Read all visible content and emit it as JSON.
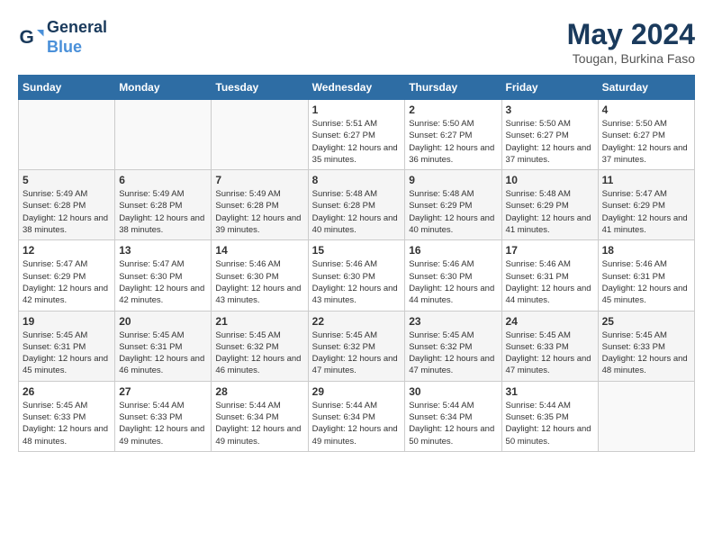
{
  "logo": {
    "line1": "General",
    "line2": "Blue"
  },
  "title": "May 2024",
  "location": "Tougan, Burkina Faso",
  "days_of_week": [
    "Sunday",
    "Monday",
    "Tuesday",
    "Wednesday",
    "Thursday",
    "Friday",
    "Saturday"
  ],
  "weeks": [
    [
      {
        "day": "",
        "sunrise": "",
        "sunset": "",
        "daylight": ""
      },
      {
        "day": "",
        "sunrise": "",
        "sunset": "",
        "daylight": ""
      },
      {
        "day": "",
        "sunrise": "",
        "sunset": "",
        "daylight": ""
      },
      {
        "day": "1",
        "sunrise": "Sunrise: 5:51 AM",
        "sunset": "Sunset: 6:27 PM",
        "daylight": "Daylight: 12 hours and 35 minutes."
      },
      {
        "day": "2",
        "sunrise": "Sunrise: 5:50 AM",
        "sunset": "Sunset: 6:27 PM",
        "daylight": "Daylight: 12 hours and 36 minutes."
      },
      {
        "day": "3",
        "sunrise": "Sunrise: 5:50 AM",
        "sunset": "Sunset: 6:27 PM",
        "daylight": "Daylight: 12 hours and 37 minutes."
      },
      {
        "day": "4",
        "sunrise": "Sunrise: 5:50 AM",
        "sunset": "Sunset: 6:27 PM",
        "daylight": "Daylight: 12 hours and 37 minutes."
      }
    ],
    [
      {
        "day": "5",
        "sunrise": "Sunrise: 5:49 AM",
        "sunset": "Sunset: 6:28 PM",
        "daylight": "Daylight: 12 hours and 38 minutes."
      },
      {
        "day": "6",
        "sunrise": "Sunrise: 5:49 AM",
        "sunset": "Sunset: 6:28 PM",
        "daylight": "Daylight: 12 hours and 38 minutes."
      },
      {
        "day": "7",
        "sunrise": "Sunrise: 5:49 AM",
        "sunset": "Sunset: 6:28 PM",
        "daylight": "Daylight: 12 hours and 39 minutes."
      },
      {
        "day": "8",
        "sunrise": "Sunrise: 5:48 AM",
        "sunset": "Sunset: 6:28 PM",
        "daylight": "Daylight: 12 hours and 40 minutes."
      },
      {
        "day": "9",
        "sunrise": "Sunrise: 5:48 AM",
        "sunset": "Sunset: 6:29 PM",
        "daylight": "Daylight: 12 hours and 40 minutes."
      },
      {
        "day": "10",
        "sunrise": "Sunrise: 5:48 AM",
        "sunset": "Sunset: 6:29 PM",
        "daylight": "Daylight: 12 hours and 41 minutes."
      },
      {
        "day": "11",
        "sunrise": "Sunrise: 5:47 AM",
        "sunset": "Sunset: 6:29 PM",
        "daylight": "Daylight: 12 hours and 41 minutes."
      }
    ],
    [
      {
        "day": "12",
        "sunrise": "Sunrise: 5:47 AM",
        "sunset": "Sunset: 6:29 PM",
        "daylight": "Daylight: 12 hours and 42 minutes."
      },
      {
        "day": "13",
        "sunrise": "Sunrise: 5:47 AM",
        "sunset": "Sunset: 6:30 PM",
        "daylight": "Daylight: 12 hours and 42 minutes."
      },
      {
        "day": "14",
        "sunrise": "Sunrise: 5:46 AM",
        "sunset": "Sunset: 6:30 PM",
        "daylight": "Daylight: 12 hours and 43 minutes."
      },
      {
        "day": "15",
        "sunrise": "Sunrise: 5:46 AM",
        "sunset": "Sunset: 6:30 PM",
        "daylight": "Daylight: 12 hours and 43 minutes."
      },
      {
        "day": "16",
        "sunrise": "Sunrise: 5:46 AM",
        "sunset": "Sunset: 6:30 PM",
        "daylight": "Daylight: 12 hours and 44 minutes."
      },
      {
        "day": "17",
        "sunrise": "Sunrise: 5:46 AM",
        "sunset": "Sunset: 6:31 PM",
        "daylight": "Daylight: 12 hours and 44 minutes."
      },
      {
        "day": "18",
        "sunrise": "Sunrise: 5:46 AM",
        "sunset": "Sunset: 6:31 PM",
        "daylight": "Daylight: 12 hours and 45 minutes."
      }
    ],
    [
      {
        "day": "19",
        "sunrise": "Sunrise: 5:45 AM",
        "sunset": "Sunset: 6:31 PM",
        "daylight": "Daylight: 12 hours and 45 minutes."
      },
      {
        "day": "20",
        "sunrise": "Sunrise: 5:45 AM",
        "sunset": "Sunset: 6:31 PM",
        "daylight": "Daylight: 12 hours and 46 minutes."
      },
      {
        "day": "21",
        "sunrise": "Sunrise: 5:45 AM",
        "sunset": "Sunset: 6:32 PM",
        "daylight": "Daylight: 12 hours and 46 minutes."
      },
      {
        "day": "22",
        "sunrise": "Sunrise: 5:45 AM",
        "sunset": "Sunset: 6:32 PM",
        "daylight": "Daylight: 12 hours and 47 minutes."
      },
      {
        "day": "23",
        "sunrise": "Sunrise: 5:45 AM",
        "sunset": "Sunset: 6:32 PM",
        "daylight": "Daylight: 12 hours and 47 minutes."
      },
      {
        "day": "24",
        "sunrise": "Sunrise: 5:45 AM",
        "sunset": "Sunset: 6:33 PM",
        "daylight": "Daylight: 12 hours and 47 minutes."
      },
      {
        "day": "25",
        "sunrise": "Sunrise: 5:45 AM",
        "sunset": "Sunset: 6:33 PM",
        "daylight": "Daylight: 12 hours and 48 minutes."
      }
    ],
    [
      {
        "day": "26",
        "sunrise": "Sunrise: 5:45 AM",
        "sunset": "Sunset: 6:33 PM",
        "daylight": "Daylight: 12 hours and 48 minutes."
      },
      {
        "day": "27",
        "sunrise": "Sunrise: 5:44 AM",
        "sunset": "Sunset: 6:33 PM",
        "daylight": "Daylight: 12 hours and 49 minutes."
      },
      {
        "day": "28",
        "sunrise": "Sunrise: 5:44 AM",
        "sunset": "Sunset: 6:34 PM",
        "daylight": "Daylight: 12 hours and 49 minutes."
      },
      {
        "day": "29",
        "sunrise": "Sunrise: 5:44 AM",
        "sunset": "Sunset: 6:34 PM",
        "daylight": "Daylight: 12 hours and 49 minutes."
      },
      {
        "day": "30",
        "sunrise": "Sunrise: 5:44 AM",
        "sunset": "Sunset: 6:34 PM",
        "daylight": "Daylight: 12 hours and 50 minutes."
      },
      {
        "day": "31",
        "sunrise": "Sunrise: 5:44 AM",
        "sunset": "Sunset: 6:35 PM",
        "daylight": "Daylight: 12 hours and 50 minutes."
      },
      {
        "day": "",
        "sunrise": "",
        "sunset": "",
        "daylight": ""
      }
    ]
  ]
}
